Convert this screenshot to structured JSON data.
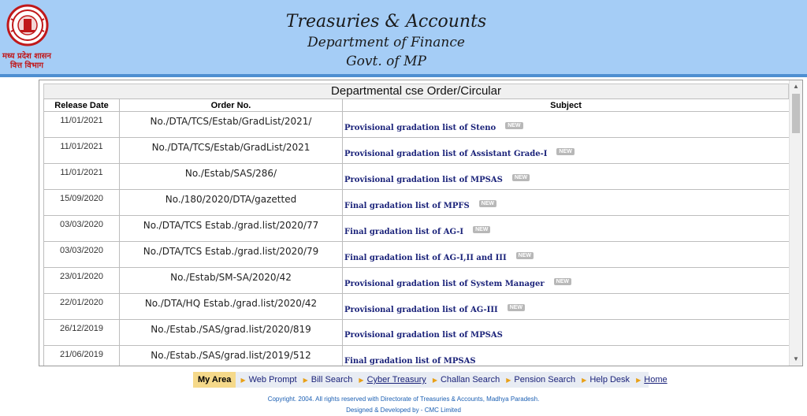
{
  "header": {
    "logo_text": "मध्य प्रदेश शासन वित्त विभाग",
    "logo_line1": "मध्य प्रदेश शासन",
    "logo_line2": "वित्त विभाग",
    "title1": "Treasuries & Accounts",
    "title2": "Department of Finance",
    "title3": "Govt. of MP"
  },
  "panel": {
    "title": "Departmental cse Order/Circular",
    "columns": [
      "Release Date",
      "Order No.",
      "Subject"
    ],
    "badge_label": "NEW",
    "rows": [
      {
        "date": "11/01/2021",
        "order": "No./DTA/TCS/Estab/GradList/2021/",
        "subject": "Provisional gradation list of Steno",
        "new": true
      },
      {
        "date": "11/01/2021",
        "order": "No./DTA/TCS/Estab/GradList/2021",
        "subject": "Provisional gradation list of Assistant Grade-I",
        "new": true
      },
      {
        "date": "11/01/2021",
        "order": "No./Estab/SAS/286/",
        "subject": "Provisional gradation list of MPSAS",
        "new": true
      },
      {
        "date": "15/09/2020",
        "order": "No./180/2020/DTA/gazetted",
        "subject": "Final gradation list of MPFS",
        "new": true
      },
      {
        "date": "03/03/2020",
        "order": "No./DTA/TCS Estab./grad.list/2020/77",
        "subject": "Final gradation list of AG-I",
        "new": true
      },
      {
        "date": "03/03/2020",
        "order": "No./DTA/TCS Estab./grad.list/2020/79",
        "subject": "Final gradation list of AG-I,II and III",
        "new": true
      },
      {
        "date": "23/01/2020",
        "order": "No./Estab/SM-SA/2020/42",
        "subject": "Provisional gradation list of System Manager",
        "new": true
      },
      {
        "date": "22/01/2020",
        "order": "No./DTA/HQ Estab./grad.list/2020/42",
        "subject": "Provisional gradation list of AG-III",
        "new": true
      },
      {
        "date": "26/12/2019",
        "order": "No./Estab./SAS/grad.list/2020/819",
        "subject": "Provisional gradation list of MPSAS",
        "new": false
      },
      {
        "date": "21/06/2019",
        "order": "No./Estab./SAS/grad.list/2019/512",
        "subject": "Final gradation list of MPSAS",
        "new": false
      }
    ]
  },
  "nav": {
    "items": [
      "My Area",
      "Web Prompt",
      "Bill Search",
      "Cyber Treasury",
      "Challan Search",
      "Pension Search",
      "Help Desk",
      "Home"
    ]
  },
  "footer": {
    "copyright": "Copyright. 2004. All rights reserved with Directorate of Treasuries & Accounts, Madhya Paradesh.",
    "designed": "Designed & Developed by - CMC Limited"
  },
  "colors": {
    "header_bg": "#a5cdf6",
    "link": "#1b237a",
    "nav_active": "#f5d98a"
  }
}
